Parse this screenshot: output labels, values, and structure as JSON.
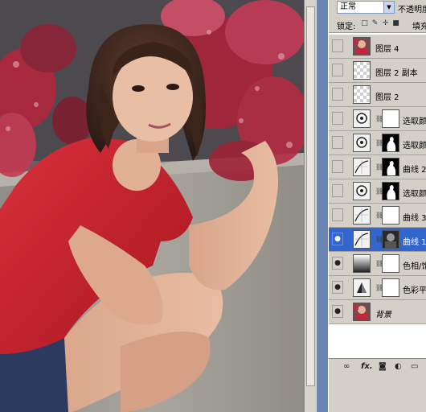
{
  "layers_panel": {
    "blend_mode": "正常",
    "opacity_label": "不透明度",
    "lock_label": "锁定:",
    "fill_label": "填充",
    "lock_icons": [
      "lock-transparency-icon",
      "lock-brush-icon",
      "lock-move-icon",
      "lock-all-icon"
    ],
    "layers": [
      {
        "name": "图层 4",
        "visible": false,
        "thumb": "photo",
        "mask": null,
        "selected": false,
        "italic": false
      },
      {
        "name": "图层 2 副本",
        "visible": false,
        "thumb": "transparent",
        "mask": null,
        "selected": false,
        "italic": false
      },
      {
        "name": "图层 2",
        "visible": false,
        "thumb": "transparent",
        "mask": null,
        "selected": false,
        "italic": false
      },
      {
        "name": "选取颜色",
        "visible": false,
        "thumb": "selective-color",
        "mask": "white",
        "selected": false,
        "italic": false
      },
      {
        "name": "选取颜色",
        "visible": false,
        "thumb": "selective-color",
        "mask": "silhouette",
        "selected": false,
        "italic": false
      },
      {
        "name": "曲线 2",
        "visible": false,
        "thumb": "curves",
        "mask": "silhouette",
        "selected": false,
        "italic": false
      },
      {
        "name": "选取颜色",
        "visible": false,
        "thumb": "selective-color",
        "mask": "silhouette",
        "selected": false,
        "italic": false
      },
      {
        "name": "曲线 3",
        "visible": false,
        "thumb": "curves",
        "mask": "white",
        "selected": false,
        "italic": false
      },
      {
        "name": "曲线 1",
        "visible": true,
        "thumb": "curves",
        "mask": "photo-dark",
        "selected": true,
        "italic": false
      },
      {
        "name": "色相/饱和",
        "visible": true,
        "thumb": "hue-saturation",
        "mask": "white",
        "selected": false,
        "italic": false
      },
      {
        "name": "色彩平衡",
        "visible": true,
        "thumb": "color-balance",
        "mask": "white",
        "selected": false,
        "italic": false
      },
      {
        "name": "背景",
        "visible": true,
        "thumb": "photo",
        "mask": null,
        "selected": false,
        "italic": true
      }
    ],
    "bottom_icons": [
      "link-layers-icon",
      "fx-icon",
      "add-mask-icon",
      "adjustment-layer-icon",
      "new-group-icon"
    ],
    "fx_label": "fx."
  },
  "colors": {
    "selection": "#3366cc",
    "panel": "#d4d0c8",
    "workspace": "#6e86b6"
  }
}
